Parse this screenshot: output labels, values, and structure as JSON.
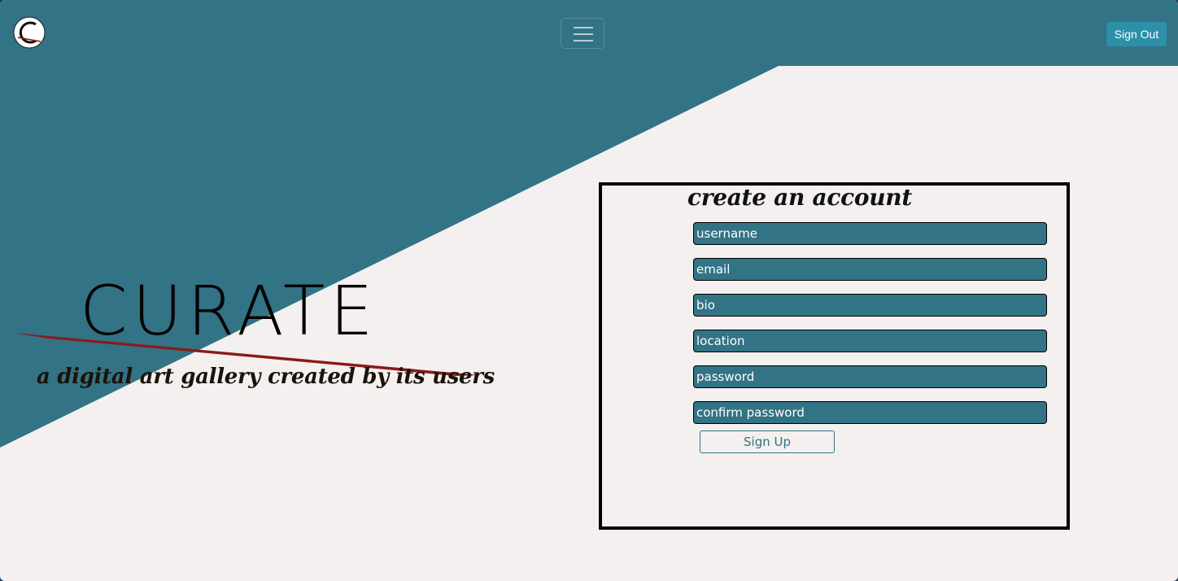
{
  "colors": {
    "primary": "#327385",
    "background": "#f4f0ef",
    "accent_slash": "#8b1a1a",
    "sign_out_button": "#2e8fa8"
  },
  "navbar": {
    "logo_icon": "curate-logo-icon",
    "toggler_icon": "hamburger-menu-icon",
    "sign_out_label": "Sign Out"
  },
  "hero": {
    "title": "CURATE",
    "tagline": "a digital art gallery created by its users"
  },
  "form": {
    "heading": "create an account",
    "fields": [
      {
        "placeholder": "username"
      },
      {
        "placeholder": "email"
      },
      {
        "placeholder": "bio"
      },
      {
        "placeholder": "location"
      },
      {
        "placeholder": "password"
      },
      {
        "placeholder": "confirm password"
      }
    ],
    "submit_label": "Sign Up"
  }
}
